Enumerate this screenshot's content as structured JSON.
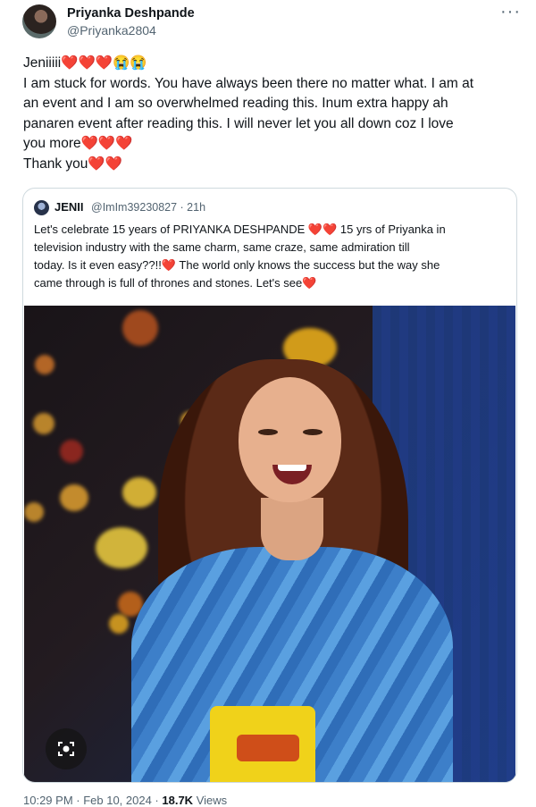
{
  "author": {
    "name": "Priyanka Deshpande",
    "handle": "@Priyanka2804"
  },
  "more_label": "···",
  "tweet": {
    "lines": [
      "Jeniiiii❤️❤️❤️😭😭",
      "I am stuck for words. You have always been there no matter what. I am at",
      "an event and I am so overwhelmed reading this. Inum extra happy ah",
      "panaren event after reading this. I will never let you all down coz I love",
      "you more❤️❤️❤️",
      "Thank you❤️❤️"
    ]
  },
  "quote": {
    "name": "JENII",
    "meta": "@ImIm39230827 · 21h",
    "lines": [
      "Let's celebrate 15 years of PRIYANKA DESHPANDE ❤️❤️ 15 yrs of Priyanka in",
      "television industry with the same charm, same craze, same admiration till",
      "today. Is it even easy??!!❤️ The world only knows the success but the way she",
      "came through is full of thrones and stones. Let's see❤️"
    ]
  },
  "footer": {
    "time": "10:29 PM · Feb 10, 2024 · ",
    "views_count": "18.7K",
    "views_label": " Views"
  },
  "icons": {
    "lens": "google-lens-icon",
    "more": "more-options-icon"
  },
  "colors": {
    "heart": "#e0245e",
    "muted": "#536471",
    "text": "#0f1419",
    "border": "#cfd9de"
  }
}
